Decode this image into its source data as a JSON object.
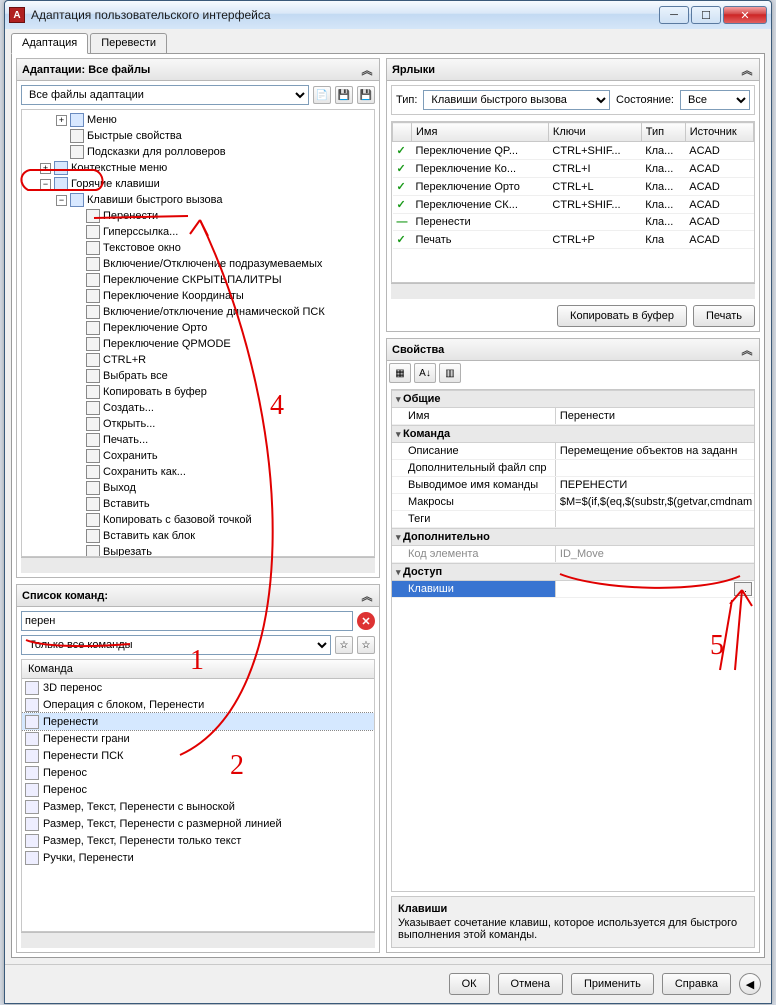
{
  "window": {
    "title": "Адаптация пользовательского интерфейса"
  },
  "tabs": {
    "adapt": "Адаптация",
    "translate": "Перевести"
  },
  "adaptations": {
    "title": "Адаптации: Все файлы",
    "dropdown": "Все файлы адаптации",
    "tree": {
      "menu": "Меню",
      "quickprops": "Быстрые свойства",
      "rollover": "Подсказки для ролловеров",
      "context": "Контекстные меню",
      "hotkeys": "Горячие клавиши",
      "shortcuts": "Клавиши быстрого вызова",
      "items": [
        "Перенести",
        "Гиперссылка...",
        "Текстовое окно",
        "Включение/Отключение подразумеваемых",
        "Переключение СКРЫТЬПАЛИТРЫ",
        "Переключение Координаты",
        "Включение/отключение динамической ПСК",
        "Переключение Орто",
        "Переключение QPMODE",
        "CTRL+R",
        "Выбрать все",
        "Копировать в буфер",
        "Создать...",
        "Открыть...",
        "Печать...",
        "Сохранить",
        "Сохранить как...",
        "Выход",
        "Вставить",
        "Копировать с базовой точкой",
        "Вставить как блок",
        "Вырезать"
      ]
    }
  },
  "commands": {
    "title": "Список команд:",
    "search": "перен",
    "filter": "Только все команды",
    "header": "Команда",
    "list": [
      "3D перенос",
      "Операция с блоком, Перенести",
      "Перенести",
      "Перенести грани",
      "Перенести ПСК",
      "Перенос",
      "Перенос",
      "Размер, Текст, Перенести с выноской",
      "Размер, Текст, Перенести с размерной линией",
      "Размер, Текст, Перенести только текст",
      "Ручки, Перенести"
    ],
    "selected_index": 2
  },
  "shortcuts": {
    "title": "Ярлыки",
    "type_label": "Тип:",
    "type_value": "Клавиши быстрого вызова",
    "state_label": "Состояние:",
    "state_value": "Все",
    "columns": {
      "name": "Имя",
      "keys": "Ключи",
      "type": "Тип",
      "source": "Источник"
    },
    "rows": [
      {
        "ok": true,
        "name": "Переключение QP...",
        "keys": "CTRL+SHIF...",
        "type": "Кла...",
        "src": "ACAD"
      },
      {
        "ok": true,
        "name": "Переключение Ко...",
        "keys": "CTRL+I",
        "type": "Кла...",
        "src": "ACAD"
      },
      {
        "ok": true,
        "name": "Переключение Орто",
        "keys": "CTRL+L",
        "type": "Кла...",
        "src": "ACAD"
      },
      {
        "ok": true,
        "name": "Переключение СК...",
        "keys": "CTRL+SHIF...",
        "type": "Кла...",
        "src": "ACAD"
      },
      {
        "ok": false,
        "name": "Перенести",
        "keys": "",
        "type": "Кла...",
        "src": "ACAD"
      },
      {
        "ok": true,
        "name": "Печать",
        "keys": "CTRL+P",
        "type": "Кла",
        "src": "ACAD"
      }
    ],
    "copy_btn": "Копировать в буфер",
    "print_btn": "Печать"
  },
  "props": {
    "title": "Свойства",
    "cats": {
      "general": "Общие",
      "name": "Имя",
      "name_val": "Перенести",
      "command": "Команда",
      "desc": "Описание",
      "desc_val": "Перемещение объектов на заданн",
      "extra_file": "Дополнительный файл спр",
      "out_name": "Выводимое имя команды",
      "out_name_val": "ПЕРЕНЕСТИ",
      "macros": "Макросы",
      "macros_val": "$M=$(if,$(eq,$(substr,$(getvar,cmdnam",
      "tags": "Теги",
      "additional": "Дополнительно",
      "elem_code": "Код элемента",
      "elem_code_val": "ID_Move",
      "access": "Доступ",
      "keys": "Клавиши"
    },
    "help_title": "Клавиши",
    "help_text": "Указывает сочетание клавиш, которое используется для быстрого выполнения этой команды."
  },
  "footer": {
    "ok": "ОК",
    "cancel": "Отмена",
    "apply": "Применить",
    "help": "Справка"
  },
  "anno": {
    "n1": "1",
    "n2": "2",
    "n4": "4",
    "n5": "5"
  }
}
